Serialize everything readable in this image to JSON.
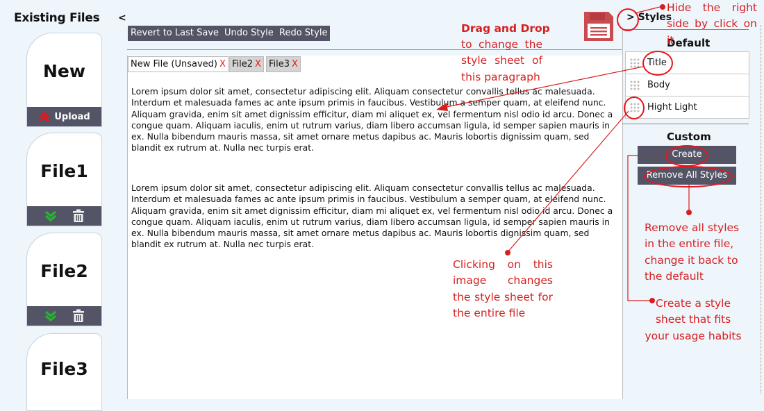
{
  "left_panel": {
    "title": "Existing Files",
    "collapse_glyph": "<",
    "new_card": {
      "label": "New",
      "upload_label": "Upload"
    },
    "files": [
      {
        "name": "File1"
      },
      {
        "name": "File2"
      },
      {
        "name": "File3"
      }
    ]
  },
  "toolbar": {
    "revert_label": "Revert to Last Save",
    "undo_label": "Undo Style",
    "redo_label": "Redo Style"
  },
  "tabs": [
    {
      "label": "New File (Unsaved)",
      "close": "X",
      "active": true
    },
    {
      "label": "File2",
      "close": "X",
      "active": false
    },
    {
      "label": "File3",
      "close": "X",
      "active": false
    }
  ],
  "document": {
    "paragraphs": [
      "Lorem ipsum dolor sit amet, consectetur adipiscing elit. Aliquam consectetur convallis tellus ac malesuada. Interdum et malesuada fames ac ante ipsum primis in faucibus. Vestibulum a semper quam, at eleifend nunc. Aliquam gravida, enim sit amet dignissim efficitur, diam mi aliquet ex, vel fermentum nisl odio id arcu. Donec a congue quam. Aliquam iaculis, enim ut rutrum varius, diam libero accumsan ligula, id semper sapien mauris in ex. Nulla bibendum mauris massa, sit amet ornare metus dapibus ac. Mauris lobortis dignissim quam, sed blandit ex rutrum at. Nulla nec turpis erat.",
      "Lorem ipsum dolor sit amet, consectetur adipiscing elit. Aliquam consectetur convallis tellus ac malesuada. Interdum et malesuada fames ac ante ipsum primis in faucibus. Vestibulum a semper quam, at eleifend nunc. Aliquam gravida, enim sit amet dignissim efficitur, diam mi aliquet ex, vel fermentum nisl odio id arcu. Donec a congue quam. Aliquam iaculis, enim ut rutrum varius, diam libero accumsan ligula, id semper sapien mauris in ex. Nulla bibendum mauris massa, sit amet ornare metus dapibus ac. Mauris lobortis dignissim quam, sed blandit ex rutrum at. Nulla nec turpis erat."
    ]
  },
  "right_panel": {
    "toggle_label": "> Styles",
    "default_heading": "Default",
    "default_styles": [
      {
        "label": "Title"
      },
      {
        "label": "Body"
      },
      {
        "label": "Hight Light"
      }
    ],
    "custom_heading": "Custom",
    "create_label": "Create",
    "remove_all_label": "Remove All Styles"
  },
  "annotations": {
    "hide_right": "Hide the right side by click on it",
    "drag_drop_title": "Drag and Drop",
    "drag_drop_body": "to change the style sheet of this paragraph",
    "clicking_image": "Clicking on this image changes the style sheet for the entire file",
    "remove_all": "Remove all styles in the entire file, change it back to the default",
    "create_style": "Create a style sheet that fits your usage habits"
  },
  "icons": {
    "save": "floppy-disk-icon",
    "upload": "double-chevron-up-icon",
    "download": "double-chevron-down-icon",
    "delete": "trash-icon",
    "grip": "drag-grip-icon"
  },
  "colors": {
    "dark_bar": "#535566",
    "annotation_red": "#d71f1f",
    "upload_red": "#e8151b",
    "download_green": "#22b829",
    "tab_close_red": "#e0201e",
    "page_bg": "#eef5fb"
  }
}
